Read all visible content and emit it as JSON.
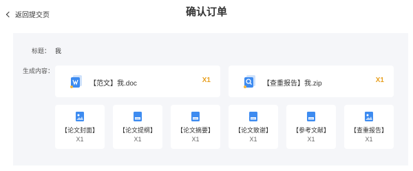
{
  "header": {
    "back_label": "返回提交页",
    "title": "确认订单"
  },
  "form": {
    "title_label": "标题：",
    "title_value": "我",
    "content_label": "生成内容："
  },
  "files": [
    {
      "name": "【范文】我.doc",
      "qty": "X1",
      "icon": "word-document-icon"
    },
    {
      "name": "【查重报告】我.zip",
      "qty": "X1",
      "icon": "zip-report-icon"
    }
  ],
  "items": [
    {
      "label": "【论文封面】",
      "qty": "X1",
      "icon": "image-file-icon"
    },
    {
      "label": "【论文提纲】",
      "qty": "X1",
      "icon": "doc-file-icon"
    },
    {
      "label": "【论文摘要】",
      "qty": "X1",
      "icon": "doc-file-icon"
    },
    {
      "label": "【论文致谢】",
      "qty": "X1",
      "icon": "doc-file-icon"
    },
    {
      "label": "【参考文献】",
      "qty": "X1",
      "icon": "doc-file-icon"
    },
    {
      "label": "【查重报告】",
      "qty": "X1",
      "icon": "image-file-icon"
    }
  ],
  "colors": {
    "accent_blue": "#3d8bf0",
    "quantity_orange": "#e8a020",
    "panel_bg": "#f5f6f9"
  }
}
